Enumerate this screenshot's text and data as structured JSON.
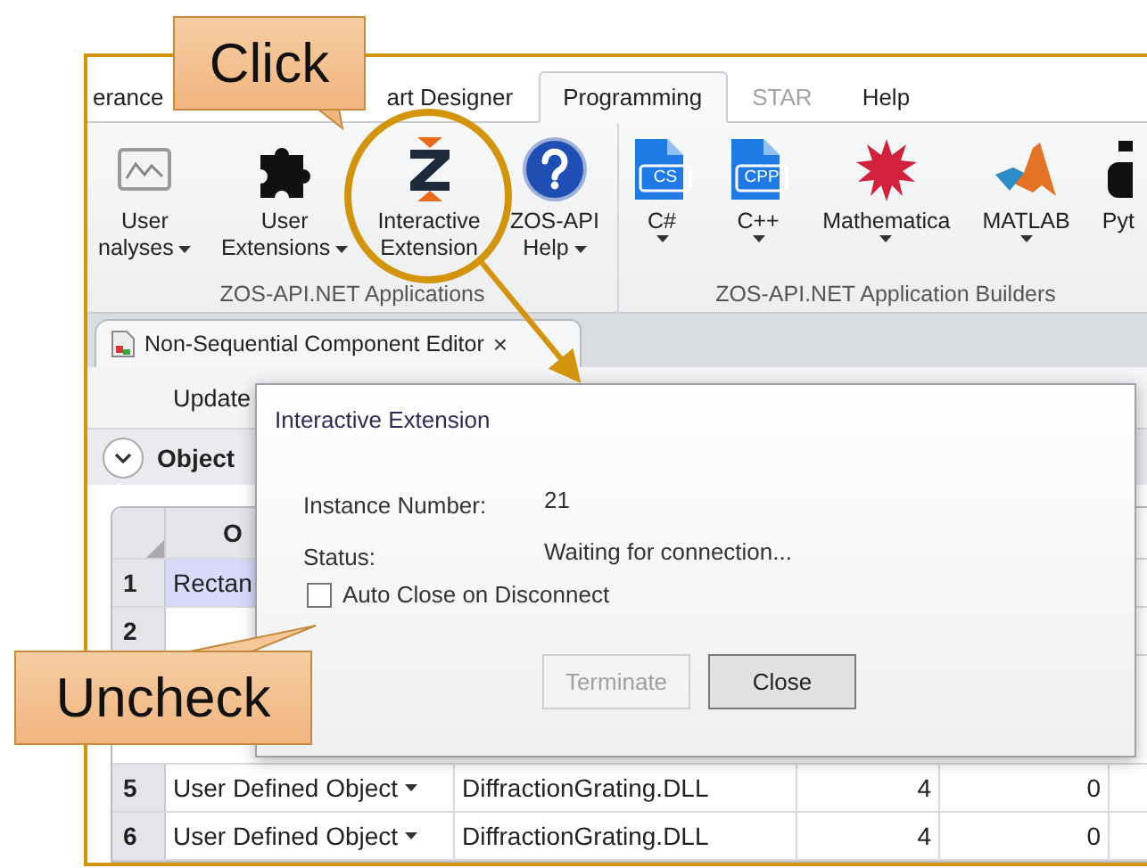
{
  "ribbon_tabs": [
    {
      "label": "erance",
      "selected": false,
      "disabled": false
    },
    {
      "label": "art Designer",
      "selected": false,
      "disabled": false
    },
    {
      "label": "Programming",
      "selected": true,
      "disabled": false
    },
    {
      "label": "STAR",
      "selected": false,
      "disabled": true
    },
    {
      "label": "Help",
      "selected": false,
      "disabled": false
    }
  ],
  "ribbon_groups": [
    {
      "title": "ZOS-API.NET Applications",
      "buttons": [
        {
          "lines": [
            "User",
            "nalyses"
          ],
          "dropdown": true
        },
        {
          "lines": [
            "User",
            "Extensions"
          ],
          "dropdown": true
        },
        {
          "lines": [
            "Interactive",
            "Extension"
          ],
          "dropdown": false
        },
        {
          "lines": [
            "ZOS-API",
            "Help"
          ],
          "dropdown": true
        }
      ]
    },
    {
      "title": "ZOS-API.NET Application Builders",
      "buttons": [
        {
          "badge": "CS",
          "lines": [
            "C#"
          ],
          "dropdown": true
        },
        {
          "badge": "CPP",
          "lines": [
            "C++"
          ],
          "dropdown": true
        },
        {
          "lines": [
            "Mathematica"
          ],
          "dropdown": true
        },
        {
          "lines": [
            "MATLAB"
          ],
          "dropdown": true
        },
        {
          "lines": [
            "Pyt"
          ],
          "dropdown": false
        }
      ]
    }
  ],
  "document_tab": {
    "title": "Non-Sequential Component Editor",
    "close": "×"
  },
  "toolbar": {
    "button": "Update"
  },
  "object_bar": {
    "label": "Object"
  },
  "table": {
    "columns": [
      "O"
    ],
    "rows": [
      {
        "number": "1",
        "cells": [
          "Rectan"
        ],
        "selected": true
      },
      {
        "number": "2",
        "cells": [],
        "selected": false
      },
      {
        "number": "5",
        "cells": [
          "User Defined Object",
          "DiffractionGrating.DLL",
          "4",
          "0"
        ],
        "selected": false,
        "dropdown": true
      },
      {
        "number": "6",
        "cells": [
          "User Defined Object",
          "DiffractionGrating.DLL",
          "4",
          "0"
        ],
        "selected": false,
        "dropdown": true
      }
    ]
  },
  "dialog": {
    "title": "Interactive Extension",
    "fields": [
      {
        "label": "Instance Number:",
        "value": "21"
      },
      {
        "label": "Status:",
        "value": "Waiting for connection..."
      }
    ],
    "checkbox": {
      "label": "Auto Close on Disconnect",
      "checked": false
    },
    "buttons": [
      {
        "label": "Terminate",
        "disabled": true
      },
      {
        "label": "Close",
        "disabled": false
      }
    ]
  },
  "callouts": [
    {
      "text": "Click"
    },
    {
      "text": "Uncheck"
    }
  ]
}
